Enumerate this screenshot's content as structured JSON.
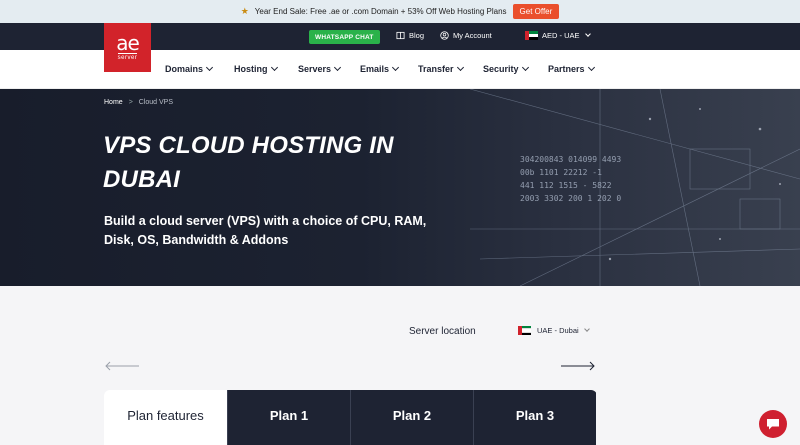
{
  "promo": {
    "text": "Year End Sale: Free .ae or .com Domain + 53% Off Web Hosting Plans",
    "button": "Get Offer"
  },
  "topbar": {
    "whatsapp": "WHATSAPP CHAT",
    "blog": "Blog",
    "account": "My Account",
    "currency": "AED - UAE"
  },
  "logo": {
    "main": "ae",
    "sub": "server"
  },
  "nav": {
    "items": [
      "Domains",
      "Hosting",
      "Servers",
      "Emails",
      "Transfer",
      "Security",
      "Partners"
    ]
  },
  "breadcrumb": {
    "home": "Home",
    "separator": ">",
    "current": "Cloud VPS"
  },
  "hero": {
    "title": "VPS CLOUD HOSTING IN DUBAI",
    "subtitle": "Build a cloud server (VPS) with a choice of CPU, RAM, Disk, OS, Bandwidth & Addons",
    "code_lines": [
      "304200843 014099 4493",
      "00b 1101 22212 -1",
      "441 112 1515 - 5822",
      "2003 3302 200 1 202 0"
    ]
  },
  "server_location": {
    "label": "Server location",
    "value": "UAE - Dubai"
  },
  "plans": {
    "features_label": "Plan features",
    "columns": [
      "Plan 1",
      "Plan 2",
      "Plan 3"
    ]
  },
  "colors": {
    "brand_red": "#d2232a",
    "navy": "#1e2333",
    "whatsapp_green": "#2ab24a",
    "offer_orange": "#ea4f2c"
  }
}
